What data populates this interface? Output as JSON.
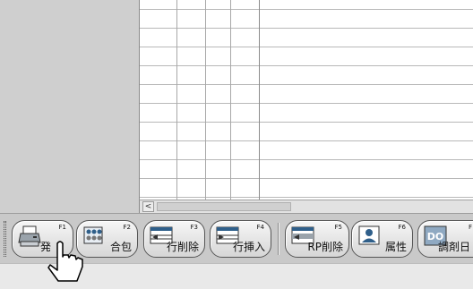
{
  "hscroll": {
    "left_arrow": "<"
  },
  "toolbar": {
    "buttons": [
      {
        "id": "f1",
        "key": "F1",
        "label": "発",
        "icon": "printer-icon"
      },
      {
        "id": "f2",
        "key": "F2",
        "label": "合包",
        "icon": "pill-package-icon"
      },
      {
        "id": "f3",
        "key": "F3",
        "label": "行削除",
        "icon": "delete-row-icon"
      },
      {
        "id": "f4",
        "key": "F4",
        "label": "行挿入",
        "icon": "insert-row-icon"
      },
      {
        "id": "f5",
        "key": "F5",
        "label": "RP削除",
        "icon": "delete-rp-icon"
      },
      {
        "id": "f6",
        "key": "F6",
        "label": "属性",
        "icon": "person-attribute-icon"
      },
      {
        "id": "f7",
        "key": "F",
        "label": "調剤日",
        "icon": "do-icon",
        "icon_text": "DO"
      }
    ]
  },
  "colors": {
    "accent": "#2f5f8a",
    "button_border": "#555555",
    "grid_bg": "#ffffff"
  }
}
